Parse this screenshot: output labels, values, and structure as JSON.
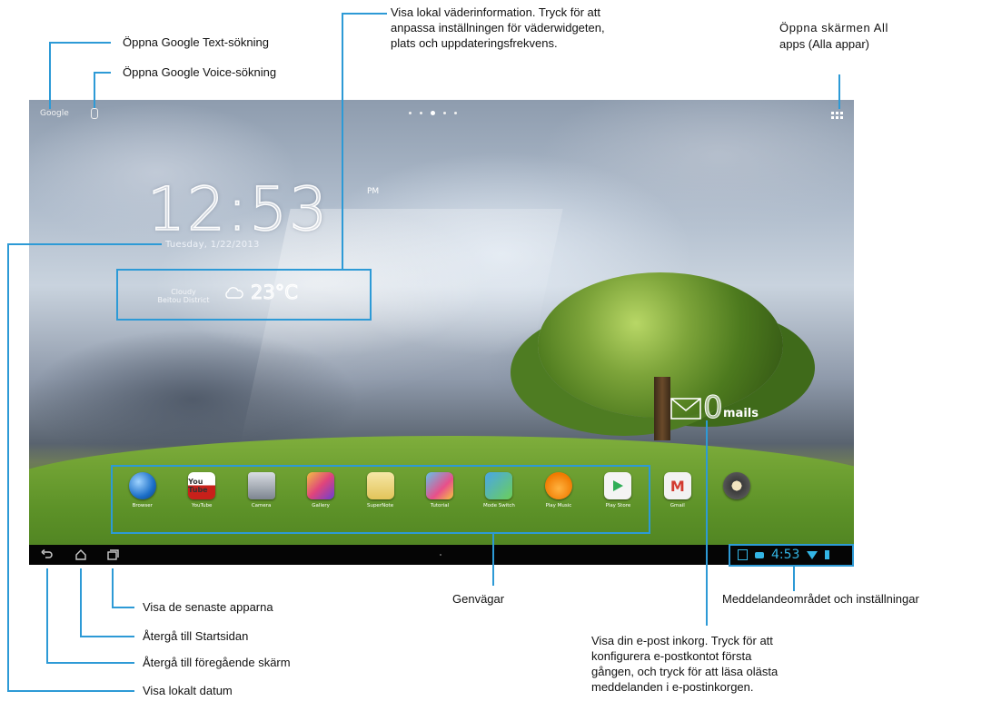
{
  "screen": {
    "top_left_search": "Google",
    "clock": "12:53",
    "ampm": "PM",
    "date": "Tuesday, 1/22/2013",
    "weather_location": "Cloudy\nBeitou District",
    "temperature": "23°C",
    "mail_count": "0",
    "mail_word": "mails",
    "time": "4:53"
  },
  "dock": [
    {
      "label": "Browser",
      "icon": "browser-icon"
    },
    {
      "label": "YouTube",
      "icon": "youtube-icon",
      "glyph": "You Tube"
    },
    {
      "label": "Camera",
      "icon": "camera-icon"
    },
    {
      "label": "Gallery",
      "icon": "gallery-icon"
    },
    {
      "label": "SuperNote",
      "icon": "supernote-icon"
    },
    {
      "label": "Tutorial",
      "icon": "tutorial-icon"
    },
    {
      "label": "Mode Switch",
      "icon": "mode-switch-icon"
    },
    {
      "label": "Play Music",
      "icon": "play-music-icon"
    },
    {
      "label": "Play Store",
      "icon": "play-store-icon"
    },
    {
      "label": "Gmail",
      "icon": "gmail-icon",
      "glyph": "M"
    },
    {
      "label": "",
      "icon": "settings-icon"
    }
  ],
  "callouts": {
    "google_text": "Öppna Google Text-sökning",
    "google_voice": "Öppna Google Voice-sökning",
    "weather_1": "Visa lokal väderinformation. Tryck för att",
    "weather_2": "anpassa inställningen för väderwidgeten,",
    "weather_3": "plats och uppdateringsfrekvens.",
    "all_apps_1": "Öppna skärmen All",
    "all_apps_2": "apps (Alla appar)",
    "recent_apps": "Visa de senaste apparna",
    "home": "Återgå till Startsidan",
    "back": "Återgå till föregående skärm",
    "date": "Visa lokalt datum",
    "shortcuts": "Genvägar",
    "notifications": "Meddelandeområdet och inställningar",
    "email_1": "Visa din e-post inkorg. Tryck för att",
    "email_2": "konfigurera e-postkontot första",
    "email_3": "gången, och tryck för att läsa olästa",
    "email_4": "meddelanden i e-postinkorgen."
  },
  "colors": {
    "callout_line": "#2d9ad6",
    "status_blue": "#33b5e5"
  }
}
